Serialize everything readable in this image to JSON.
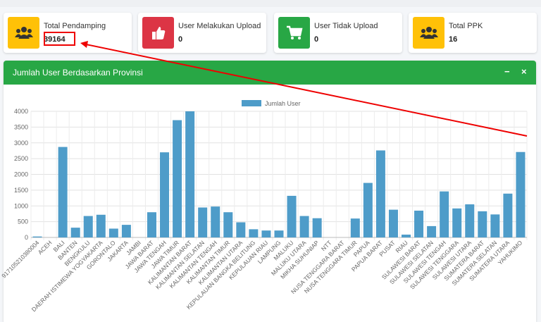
{
  "info_boxes": [
    {
      "label": "Total Pendamping",
      "value": "39164",
      "color": "#ffc107",
      "icon": "users-icon"
    },
    {
      "label": "User Melakukan Upload",
      "value": "0",
      "color": "#dc3545",
      "icon": "thumbs-up-icon"
    },
    {
      "label": "User Tidak Upload",
      "value": "0",
      "color": "#28a745",
      "icon": "cart-icon"
    },
    {
      "label": "Total PPK",
      "value": "16",
      "color": "#ffc107",
      "icon": "users-icon"
    }
  ],
  "card": {
    "title": "Jumlah User Berdasarkan Provinsi",
    "minimize_symbol": "−",
    "close_symbol": "×"
  },
  "chart_data": {
    "type": "bar",
    "title": "",
    "xlabel": "",
    "ylabel": "",
    "ylim": [
      0,
      4000
    ],
    "yticks": [
      0,
      500,
      1000,
      1500,
      2000,
      2500,
      3000,
      3500,
      4000
    ],
    "grid": true,
    "legend_position": "top-center",
    "bar_color": "#4e9cc9",
    "categories": [
      "917105210380004",
      "ACEH",
      "BALI",
      "BANTEN",
      "BENGKULU",
      "DAERAH ISTIMEWA YOGYAKARTA",
      "GORONTALO",
      "JAKARTA",
      "JAMBI",
      "JAWA BARAT",
      "JAWA TENGAH",
      "JAWA TIMUR",
      "KALIMANTAN BARAT",
      "KALIMANTAN SELATAN",
      "KALIMANTAN TENGAH",
      "KALIMANTAN TIMUR",
      "KALIMANTAN UTARA",
      "KEPULAUAN BANGKA BELITUNG",
      "KEPULAUAN RIAU",
      "LAMPUNG",
      "MALUKU",
      "MALUKU UTARA",
      "MIKHA SUHUNIAP",
      "NTT",
      "NUSA TENGGARA BARAT",
      "NUSA TENGGARA TIMUR",
      "PAPUA",
      "PAPUA BARAT",
      "PUSAT",
      "RIAU",
      "SULAWESI BARAT",
      "SULAWESI SELATAN",
      "SULAWESI TENGAH",
      "SULAWESI TENGGARA",
      "SULAWESI UTARA",
      "SUMATERA BARAT",
      "SUMATERA SELATAN",
      "SUMATERA UTARA",
      "YAHUKIMO"
    ],
    "series": [
      {
        "name": "Jumlah User",
        "values": [
          30,
          0,
          2870,
          310,
          680,
          720,
          280,
          400,
          0,
          800,
          2700,
          3720,
          4000,
          950,
          980,
          800,
          480,
          260,
          220,
          220,
          1320,
          680,
          610,
          0,
          0,
          600,
          1730,
          2760,
          880,
          90,
          850,
          360,
          1460,
          920,
          1050,
          830,
          730,
          1390,
          2710
        ]
      }
    ]
  }
}
